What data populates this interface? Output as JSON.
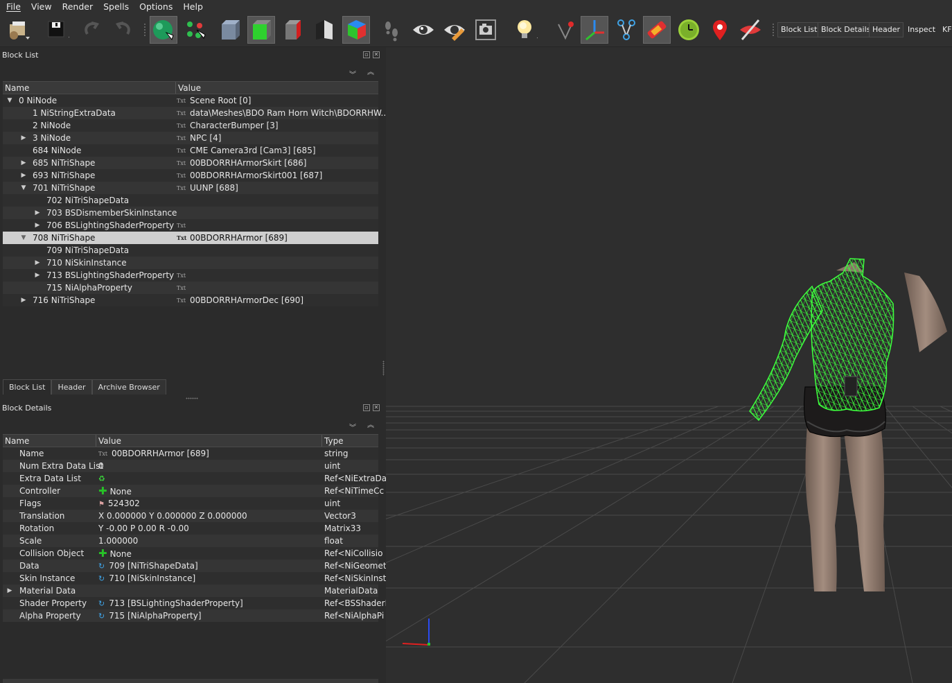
{
  "menu": [
    "File",
    "View",
    "Render",
    "Spells",
    "Options",
    "Help"
  ],
  "toolbar": {
    "icons": [
      "load-icon",
      "save-icon",
      "undo-icon",
      "redo-icon",
      "sphere-select-icon",
      "node-select-icon",
      "box-icon",
      "green-box-icon",
      "red-box-icon",
      "flip-icon",
      "color-cube-icon",
      "footprints-icon",
      "eye-icon",
      "eye-pencil-icon",
      "camera-icon",
      "light-bulb-icon",
      "vertex-pin-icon",
      "axes-icon",
      "skeleton-icon",
      "paintbrush-icon",
      "clock-icon",
      "map-marker-icon",
      "hide-icon"
    ],
    "text_buttons": [
      "Block List",
      "Block Details",
      "Header",
      "Inspect",
      "KF"
    ]
  },
  "block_list": {
    "title": "Block List",
    "columns": [
      "Name",
      "Value"
    ],
    "rows": [
      {
        "name": "0 NiNode",
        "value": "Scene Root [0]"
      },
      {
        "name": "1 NiStringExtraData",
        "value": "data\\Meshes\\BDO Ram Horn Witch\\BDORRHW..."
      },
      {
        "name": "2 NiNode",
        "value": "CharacterBumper [3]"
      },
      {
        "name": "3 NiNode",
        "value": "NPC [4]"
      },
      {
        "name": "684 NiNode",
        "value": "CME Camera3rd [Cam3] [685]"
      },
      {
        "name": "685 NiTriShape",
        "value": "00BDORRHArmorSkirt [686]"
      },
      {
        "name": "693 NiTriShape",
        "value": "00BDORRHArmorSkirt001 [687]"
      },
      {
        "name": "701 NiTriShape",
        "value": "UUNP [688]"
      },
      {
        "name": "702 NiTriShapeData",
        "value": ""
      },
      {
        "name": "703 BSDismemberSkinInstance",
        "value": ""
      },
      {
        "name": "706 BSLightingShaderProperty",
        "value": ""
      },
      {
        "name": "708 NiTriShape",
        "value": "00BDORRHArmor [689]"
      },
      {
        "name": "709 NiTriShapeData",
        "value": ""
      },
      {
        "name": "710 NiSkinInstance",
        "value": ""
      },
      {
        "name": "713 BSLightingShaderProperty",
        "value": ""
      },
      {
        "name": "715 NiAlphaProperty",
        "value": ""
      },
      {
        "name": "716 NiTriShape",
        "value": "00BDORRHArmorDec [690]"
      }
    ]
  },
  "tabs": [
    "Block List",
    "Header",
    "Archive Browser"
  ],
  "block_details": {
    "title": "Block Details",
    "columns": [
      "Name",
      "Value",
      "Type"
    ],
    "rows": [
      {
        "name": "Name",
        "value": "00BDORRHArmor [689]",
        "type": "string"
      },
      {
        "name": "Num Extra Data List",
        "value": "0",
        "type": "uint"
      },
      {
        "name": "Extra Data List",
        "value": "",
        "type": "Ref<NiExtraDa"
      },
      {
        "name": "Controller",
        "value": "None",
        "type": "Ref<NiTimeCc"
      },
      {
        "name": "Flags",
        "value": "524302",
        "type": "uint"
      },
      {
        "name": "Translation",
        "value": "X 0.000000 Y 0.000000 Z 0.000000",
        "type": "Vector3"
      },
      {
        "name": "Rotation",
        "value": "Y -0.00 P 0.00 R -0.00",
        "type": "Matrix33"
      },
      {
        "name": "Scale",
        "value": "1.000000",
        "type": "float"
      },
      {
        "name": "Collision Object",
        "value": "None",
        "type": "Ref<NiCollisio"
      },
      {
        "name": "Data",
        "value": "709 [NiTriShapeData]",
        "type": "Ref<NiGeomet"
      },
      {
        "name": "Skin Instance",
        "value": "710 [NiSkinInstance]",
        "type": "Ref<NiSkinInst"
      },
      {
        "name": "Material Data",
        "value": "",
        "type": "MaterialData"
      },
      {
        "name": "Shader Property",
        "value": "713 [BSLightingShaderProperty]",
        "type": "Ref<BSShaderI"
      },
      {
        "name": "Alpha Property",
        "value": "715 [NiAlphaProperty]",
        "type": "Ref<NiAlphaPi"
      }
    ]
  }
}
